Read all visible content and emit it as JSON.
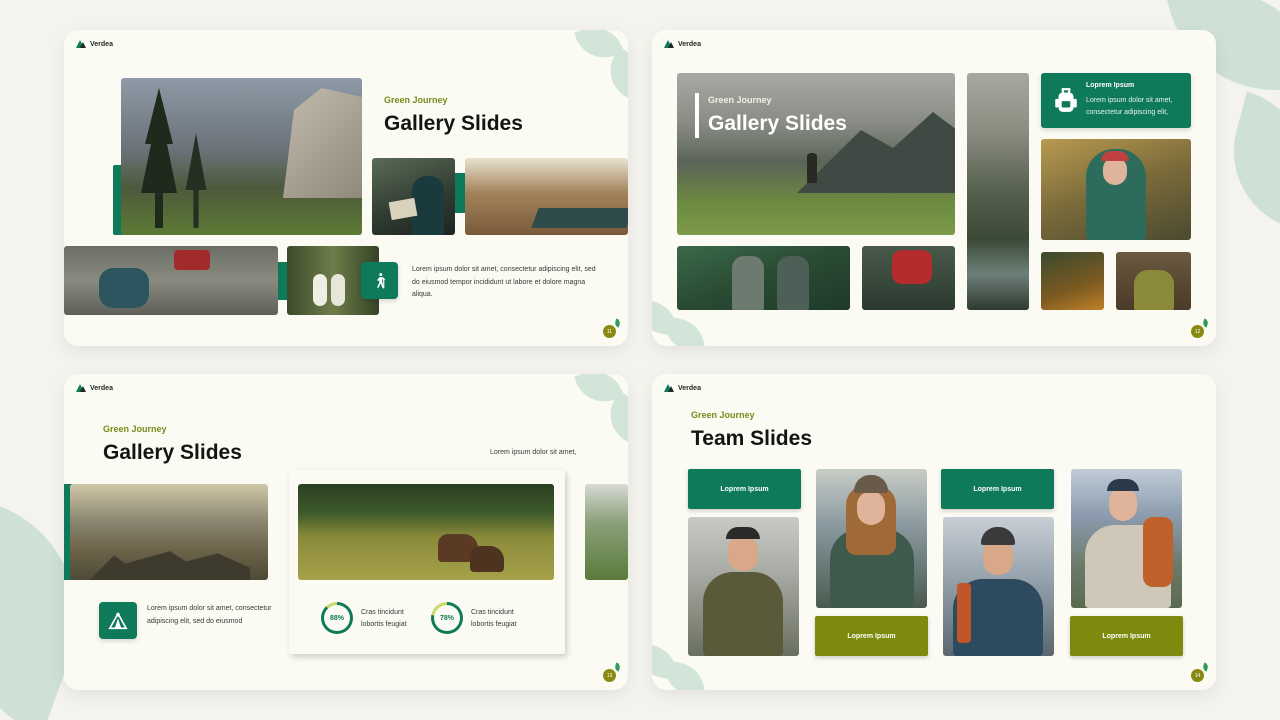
{
  "brand": {
    "name": "Verdea",
    "green": "#0f7a5a",
    "olive": "#7d8a0e",
    "text": "#141414"
  },
  "slide1": {
    "subtitle": "Green Journey",
    "title": "Gallery Slides",
    "paragraph": "Lorem ipsum dolor sit amet, consectetur adipiscing elit, sed do eiusmod tempor incididunt ut labore et dolore magna aliqua.",
    "icon": "hiker-icon",
    "page": "11"
  },
  "slide2": {
    "subtitle": "Green Journey",
    "title": "Gallery Slides",
    "card_title": "Loprem Ipsum",
    "card_text": "Lorem ipsum dolor sit amet, consectetur adipiscing elit,",
    "icon": "backpack-icon",
    "page": "12"
  },
  "slide3": {
    "subtitle": "Green Journey",
    "title": "Gallery Slides",
    "right_text": "Lorem ipsum dolor sit amet,",
    "paragraph": "Lorem ipsum dolor sit amet, consectetur adipiscing elit, sed do eiusmod",
    "icon": "tent-icon",
    "stats": [
      {
        "label": "88%",
        "value": 88,
        "text": "Cras tincidunt lobortis feugiat"
      },
      {
        "label": "78%",
        "value": 78,
        "text": "Cras tincidunt lobortis feugiat"
      }
    ],
    "page": "13"
  },
  "slide4": {
    "subtitle": "Green Journey",
    "title": "Team Slides",
    "buttons": [
      "Loprem Ipsum",
      "Loprem Ipsum",
      "Loprem Ipsum",
      "Loprem Ipsum"
    ],
    "page": "14"
  }
}
